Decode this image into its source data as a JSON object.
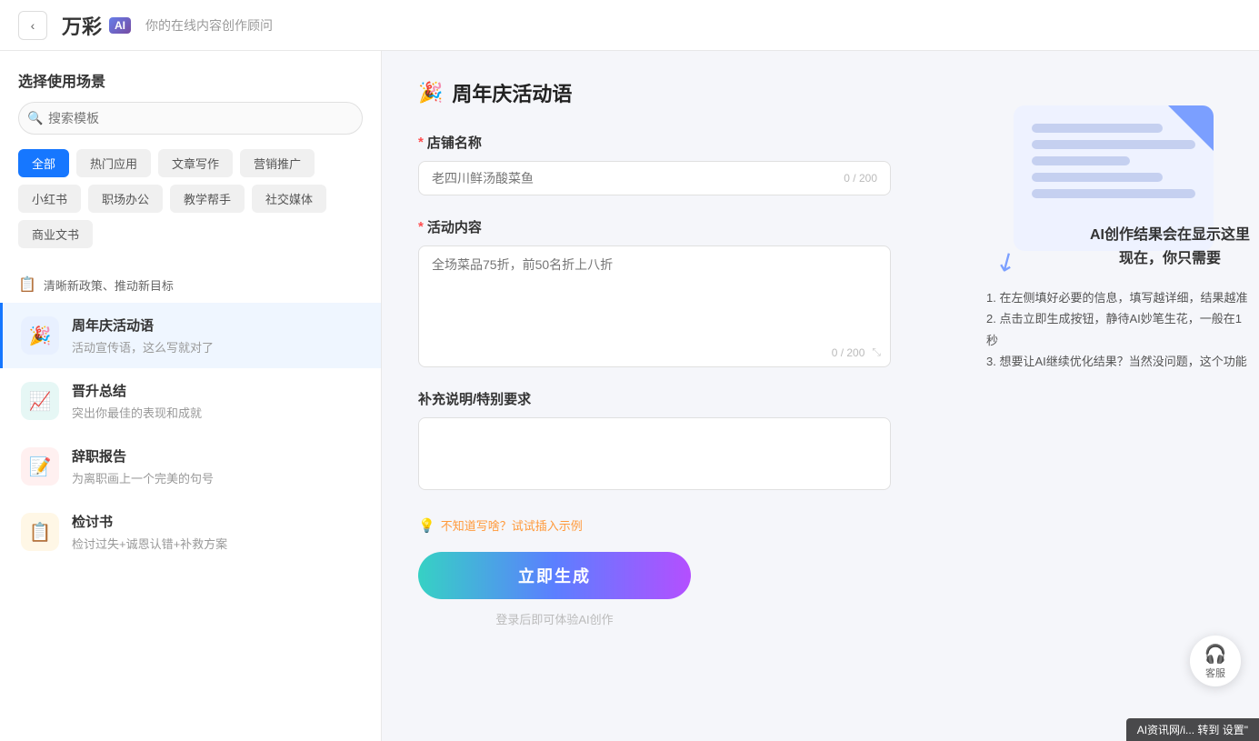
{
  "header": {
    "back_label": "‹",
    "logo_text": "万彩",
    "logo_ai": "AI",
    "subtitle": "你的在线内容创作顾问"
  },
  "sidebar": {
    "title": "选择使用场景",
    "search_placeholder": "搜索模板",
    "categories": [
      {
        "label": "全部",
        "active": true
      },
      {
        "label": "热门应用",
        "active": false
      },
      {
        "label": "文章写作",
        "active": false
      },
      {
        "label": "营销推广",
        "active": false
      },
      {
        "label": "小红书",
        "active": false
      },
      {
        "label": "职场办公",
        "active": false
      },
      {
        "label": "教学帮手",
        "active": false
      },
      {
        "label": "社交媒体",
        "active": false
      },
      {
        "label": "商业文书",
        "active": false
      }
    ],
    "policy_item": {
      "icon": "📋",
      "label": "清晰新政策、推动新目标"
    },
    "templates": [
      {
        "id": "anniversary",
        "icon": "🎉",
        "icon_class": "blue",
        "name": "周年庆活动语",
        "desc": "活动宣传语，这么写就对了",
        "active": true
      },
      {
        "id": "promotion",
        "icon": "📈",
        "icon_class": "teal",
        "name": "晋升总结",
        "desc": "突出你最佳的表现和成就",
        "active": false
      },
      {
        "id": "resignation",
        "icon": "📝",
        "icon_class": "red",
        "name": "辞职报告",
        "desc": "为离职画上一个完美的句号",
        "active": false
      },
      {
        "id": "review",
        "icon": "📋",
        "icon_class": "orange",
        "name": "检讨书",
        "desc": "检讨过失+诚恩认错+补救方案",
        "active": false
      }
    ]
  },
  "form": {
    "title": "周年庆活动语",
    "emoji": "🎉",
    "fields": {
      "store_name": {
        "label": "店铺名称",
        "required": true,
        "placeholder": "老四川鲜汤酸菜鱼",
        "char_count": "0 / 200"
      },
      "activity_content": {
        "label": "活动内容",
        "required": true,
        "placeholder": "全场菜品75折，前50名折上八折",
        "char_count": "0 / 200"
      },
      "supplement": {
        "label": "补充说明/特别要求",
        "required": false,
        "placeholder": ""
      }
    },
    "hint": {
      "icon": "💡",
      "label": "不知道写啥？试试插入示例"
    },
    "generate_btn": "立即生成",
    "login_hint": "登录后即可体验AI创作"
  },
  "illustration": {
    "ai_caption_line1": "AI创作结果会在显示这里",
    "ai_caption_line2": "现在，你只需要",
    "steps": [
      "1. 在左侧填好必要的信息，填写越详细，结果越准",
      "2. 点击立即生成按钮，静待AI妙笔生花，一般在1秒",
      "3. 想要让AI继续优化结果？当然没问题，这个功能"
    ]
  },
  "customer_service": {
    "icon": "🎧",
    "label": "客服"
  },
  "watermark": {
    "text": "AI资讯网/i..."
  }
}
